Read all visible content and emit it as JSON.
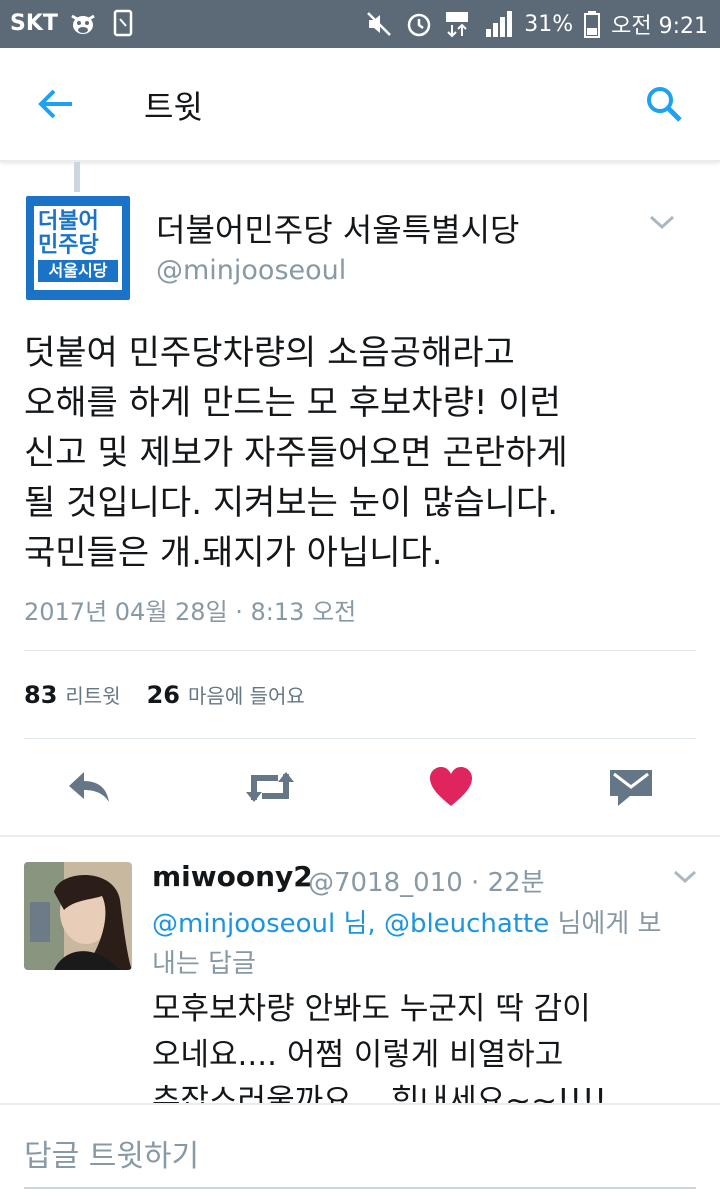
{
  "status_bar": {
    "carrier": "SKT",
    "battery": "31%",
    "time": "오전 9:21",
    "icons": [
      "cow-icon",
      "screenshot-icon",
      "mute-icon",
      "alarm-icon",
      "lte-icon",
      "signal-icon",
      "battery-icon"
    ]
  },
  "header": {
    "title": "트윗",
    "accent": "#1da1f2"
  },
  "tweet": {
    "avatar_text": "더불어\n민주당",
    "avatar_sub": "서울시당",
    "avatar_color": "#1a73c7",
    "name": "더불어민주당 서울특별시당",
    "handle": "@minjooseoul",
    "text": "덧붙여 민주당차량의 소음공해라고\n오해를 하게 만드는 모 후보차량! 이런\n신고 및 제보가 자주들어오면 곤란하게\n될 것입니다. 지켜보는 눈이 많습니다.\n국민들은 개.돼지가 아닙니다.",
    "timestamp": "2017년 04월 28일 · 8:13 오전",
    "retweets": "83",
    "retweets_label": "리트윗",
    "likes": "26",
    "likes_label": "마음에 들어요",
    "like_color": "#e0245e"
  },
  "reply": {
    "name": "miwoony2",
    "meta": "@7018_010 · 22분",
    "mention1": "@minjooseoul",
    "mention_sep": " 님, ",
    "mention2": "@bleuchatte",
    "replying_suffix": " 님에게 보내는 답글",
    "text": "모후보차량 안봐도 누군지 딱 감이\n오네요.... 어쩜 이렇게 비열하고\n추잡스러울까요...  힘내세요~~!!!!"
  },
  "composer": {
    "placeholder": "답글 트윗하기"
  }
}
